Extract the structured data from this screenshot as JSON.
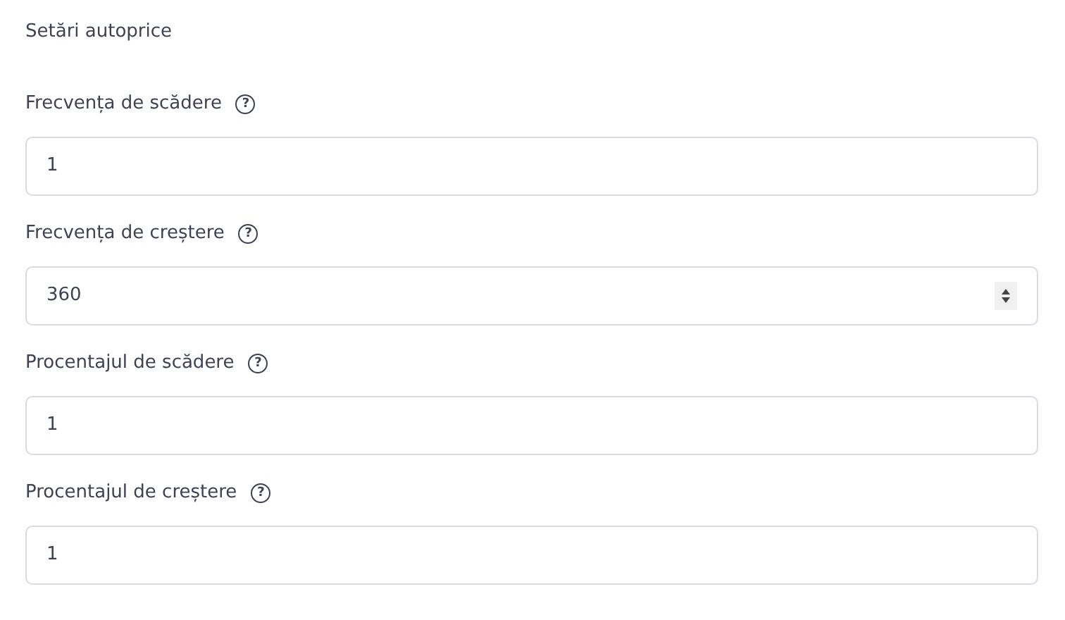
{
  "section_title": "Setări autoprice",
  "fields": [
    {
      "label": "Frecvența de scădere",
      "help_icon": "?",
      "value": "1",
      "spinner_visible": false
    },
    {
      "label": "Frecvența de creștere",
      "help_icon": "?",
      "value": "360",
      "spinner_visible": true
    },
    {
      "label": "Procentajul de scădere",
      "help_icon": "?",
      "value": "1",
      "spinner_visible": false
    },
    {
      "label": "Procentajul de creștere",
      "help_icon": "?",
      "value": "1",
      "spinner_visible": false
    }
  ]
}
